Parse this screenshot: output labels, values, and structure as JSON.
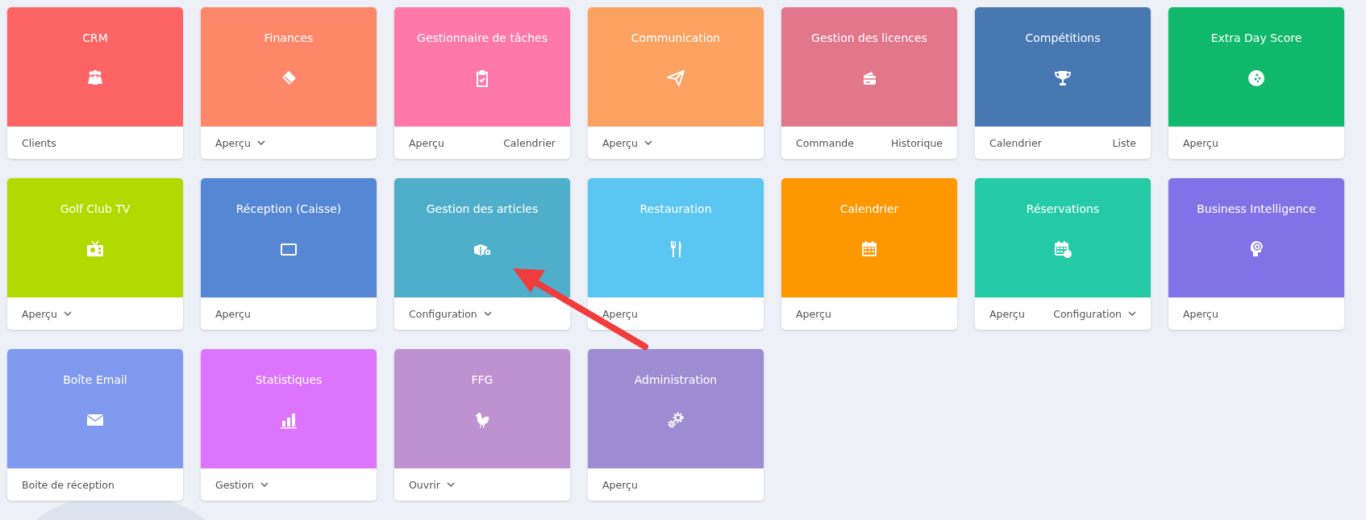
{
  "tiles": [
    {
      "title": "CRM",
      "color": "#ff6464",
      "links": [
        {
          "label": "Clients",
          "dropdown": false
        }
      ]
    },
    {
      "title": "Finances",
      "color": "#ff8769",
      "links": [
        {
          "label": "Aperçu",
          "dropdown": true
        }
      ]
    },
    {
      "title": "Gestionnaire de tâches",
      "color": "#ff79a8",
      "links": [
        {
          "label": "Aperçu",
          "dropdown": false
        },
        {
          "label": "Calendrier",
          "dropdown": false
        }
      ]
    },
    {
      "title": "Communication",
      "color": "#fca261",
      "links": [
        {
          "label": "Aperçu",
          "dropdown": true
        }
      ]
    },
    {
      "title": "Gestion des licences",
      "color": "#e2768b",
      "links": [
        {
          "label": "Commande",
          "dropdown": false
        },
        {
          "label": "Historique",
          "dropdown": false
        }
      ]
    },
    {
      "title": "Compétitions",
      "color": "#4878b2",
      "links": [
        {
          "label": "Calendrier",
          "dropdown": false
        },
        {
          "label": "Liste",
          "dropdown": false
        }
      ]
    },
    {
      "title": "Extra Day Score",
      "color": "#10b86c",
      "links": [
        {
          "label": "Aperçu",
          "dropdown": false
        }
      ]
    },
    {
      "title": "Golf Club TV",
      "color": "#b2da00",
      "links": [
        {
          "label": "Aperçu",
          "dropdown": true
        }
      ]
    },
    {
      "title": "Réception (Caisse)",
      "color": "#5587d4",
      "links": [
        {
          "label": "Aperçu",
          "dropdown": false
        }
      ]
    },
    {
      "title": "Gestion des articles",
      "color": "#4fafca",
      "links": [
        {
          "label": "Configuration",
          "dropdown": true
        }
      ]
    },
    {
      "title": "Restauration",
      "color": "#5bc6f2",
      "links": [
        {
          "label": "Aperçu",
          "dropdown": false
        }
      ]
    },
    {
      "title": "Calendrier",
      "color": "#ff9700",
      "links": [
        {
          "label": "Aperçu",
          "dropdown": false
        }
      ]
    },
    {
      "title": "Réservations",
      "color": "#25caa6",
      "links": [
        {
          "label": "Aperçu",
          "dropdown": false
        },
        {
          "label": "Configuration",
          "dropdown": true
        }
      ]
    },
    {
      "title": "Business Intelligence",
      "color": "#8272e8",
      "links": [
        {
          "label": "Aperçu",
          "dropdown": false
        }
      ]
    },
    {
      "title": "Boîte Email",
      "color": "#7f99ef",
      "links": [
        {
          "label": "Boite de réception",
          "dropdown": false
        }
      ]
    },
    {
      "title": "Statistiques",
      "color": "#dc74fd",
      "links": [
        {
          "label": "Gestion",
          "dropdown": true
        }
      ]
    },
    {
      "title": "FFG",
      "color": "#be91d1",
      "links": [
        {
          "label": "Ouvrir",
          "dropdown": true
        }
      ]
    },
    {
      "title": "Administration",
      "color": "#9e8cd2",
      "links": [
        {
          "label": "Aperçu",
          "dropdown": false
        }
      ]
    }
  ]
}
